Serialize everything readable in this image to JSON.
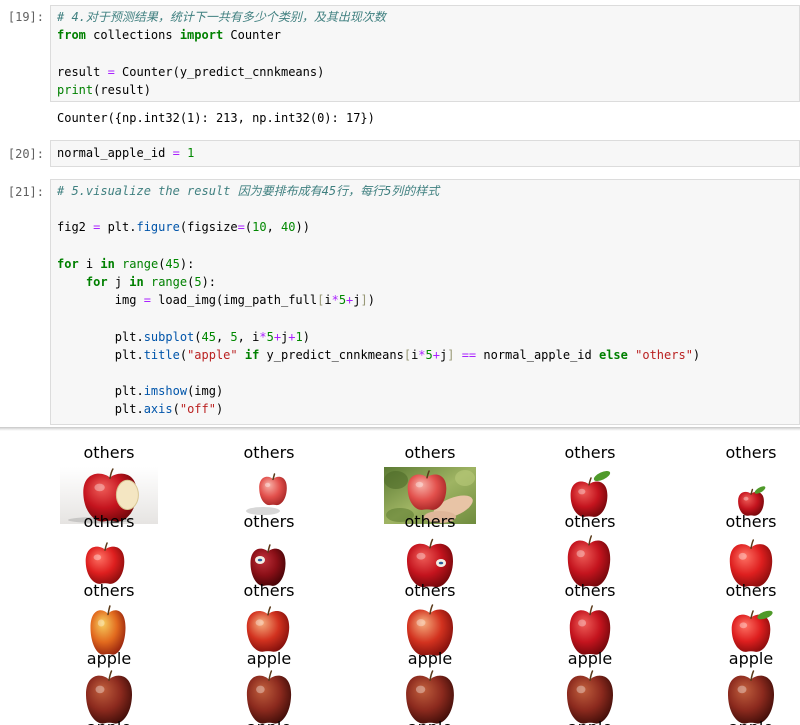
{
  "notebook": {
    "cells": [
      {
        "prompt": "[19]:",
        "code": [
          [
            {
              "comment": "# 4.对于预测结果，统计下一共有多少个类别，及其出现次数"
            }
          ],
          [
            {
              "keyword": "from"
            },
            {
              "plain": " collections "
            },
            {
              "keyword": "import"
            },
            {
              "plain": " Counter"
            }
          ],
          [],
          [
            {
              "plain": "result "
            },
            {
              "operator": "="
            },
            {
              "plain": " Counter(y_predict_cnnkmeans)"
            }
          ],
          [
            {
              "builtin": "print"
            },
            {
              "plain": "(result)"
            }
          ]
        ],
        "output": "Counter({np.int32(1): 213, np.int32(0): 17})"
      },
      {
        "prompt": "[20]:",
        "code": [
          [
            {
              "plain": "normal_apple_id "
            },
            {
              "operator": "="
            },
            {
              "plain": " "
            },
            {
              "number": "1"
            }
          ]
        ]
      },
      {
        "prompt": "[21]:",
        "code": [
          [
            {
              "comment": "# 5.visualize the result 因为要排布成有45行，每行5列的样式"
            }
          ],
          [],
          [
            {
              "plain": "fig2 "
            },
            {
              "operator": "="
            },
            {
              "plain": " plt."
            },
            {
              "property": "figure"
            },
            {
              "plain": "(figsize"
            },
            {
              "operator": "="
            },
            {
              "plain": "("
            },
            {
              "number": "10"
            },
            {
              "plain": ", "
            },
            {
              "number": "40"
            },
            {
              "plain": "))"
            }
          ],
          [],
          [
            {
              "keyword": "for"
            },
            {
              "plain": " i "
            },
            {
              "keyword": "in"
            },
            {
              "plain": " "
            },
            {
              "builtin": "range"
            },
            {
              "plain": "("
            },
            {
              "number": "45"
            },
            {
              "plain": "):"
            }
          ],
          [
            {
              "plain": "    "
            },
            {
              "keyword": "for"
            },
            {
              "plain": " j "
            },
            {
              "keyword": "in"
            },
            {
              "plain": " "
            },
            {
              "builtin": "range"
            },
            {
              "plain": "("
            },
            {
              "number": "5"
            },
            {
              "plain": "):"
            }
          ],
          [
            {
              "plain": "        img "
            },
            {
              "operator": "="
            },
            {
              "plain": " load_img(img_path_full"
            },
            {
              "bracket": "["
            },
            {
              "plain": "i"
            },
            {
              "operator": "*"
            },
            {
              "number": "5"
            },
            {
              "operator": "+"
            },
            {
              "plain": "j"
            },
            {
              "bracket": "]"
            },
            {
              "plain": ")"
            }
          ],
          [],
          [
            {
              "plain": "        plt."
            },
            {
              "property": "subplot"
            },
            {
              "plain": "("
            },
            {
              "number": "45"
            },
            {
              "plain": ", "
            },
            {
              "number": "5"
            },
            {
              "plain": ", i"
            },
            {
              "operator": "*"
            },
            {
              "number": "5"
            },
            {
              "operator": "+"
            },
            {
              "plain": "j"
            },
            {
              "operator": "+"
            },
            {
              "number": "1"
            },
            {
              "plain": ")"
            }
          ],
          [
            {
              "plain": "        plt."
            },
            {
              "property": "title"
            },
            {
              "plain": "("
            },
            {
              "string": "\"apple\""
            },
            {
              "plain": " "
            },
            {
              "keyword": "if"
            },
            {
              "plain": " y_predict_cnnkmeans"
            },
            {
              "bracket": "["
            },
            {
              "plain": "i"
            },
            {
              "operator": "*"
            },
            {
              "number": "5"
            },
            {
              "operator": "+"
            },
            {
              "plain": "j"
            },
            {
              "bracket": "]"
            },
            {
              "plain": " "
            },
            {
              "operator": "=="
            },
            {
              "plain": " normal_apple_id "
            },
            {
              "keyword": "else"
            },
            {
              "plain": " "
            },
            {
              "string": "\"others\""
            },
            {
              "plain": ")"
            }
          ],
          [],
          [
            {
              "plain": "        plt."
            },
            {
              "property": "imshow"
            },
            {
              "plain": "(img)"
            }
          ],
          [
            {
              "plain": "        plt."
            },
            {
              "property": "axis"
            },
            {
              "plain": "("
            },
            {
              "string": "\"off\""
            },
            {
              "plain": ")"
            }
          ]
        ],
        "figure": {
          "subplot_titles": [
            [
              "others",
              "others",
              "others",
              "others",
              "others"
            ],
            [
              "others",
              "others",
              "others",
              "others",
              "others"
            ],
            [
              "others",
              "others",
              "others",
              "others",
              "others"
            ],
            [
              "apple",
              "apple",
              "apple",
              "apple",
              "apple"
            ],
            [
              "apple",
              "apple",
              "apple",
              "apple",
              "apple"
            ]
          ]
        }
      }
    ]
  },
  "syntax_colors": {
    "comment": "#408080",
    "keyword": "#008000",
    "builtin": "#008000",
    "operator": "#AA22FF",
    "number": "#008800",
    "string": "#BA2121",
    "property": "#0055AA",
    "bracket": "#999977",
    "plain": "#000000",
    "prompt": "#616161"
  }
}
